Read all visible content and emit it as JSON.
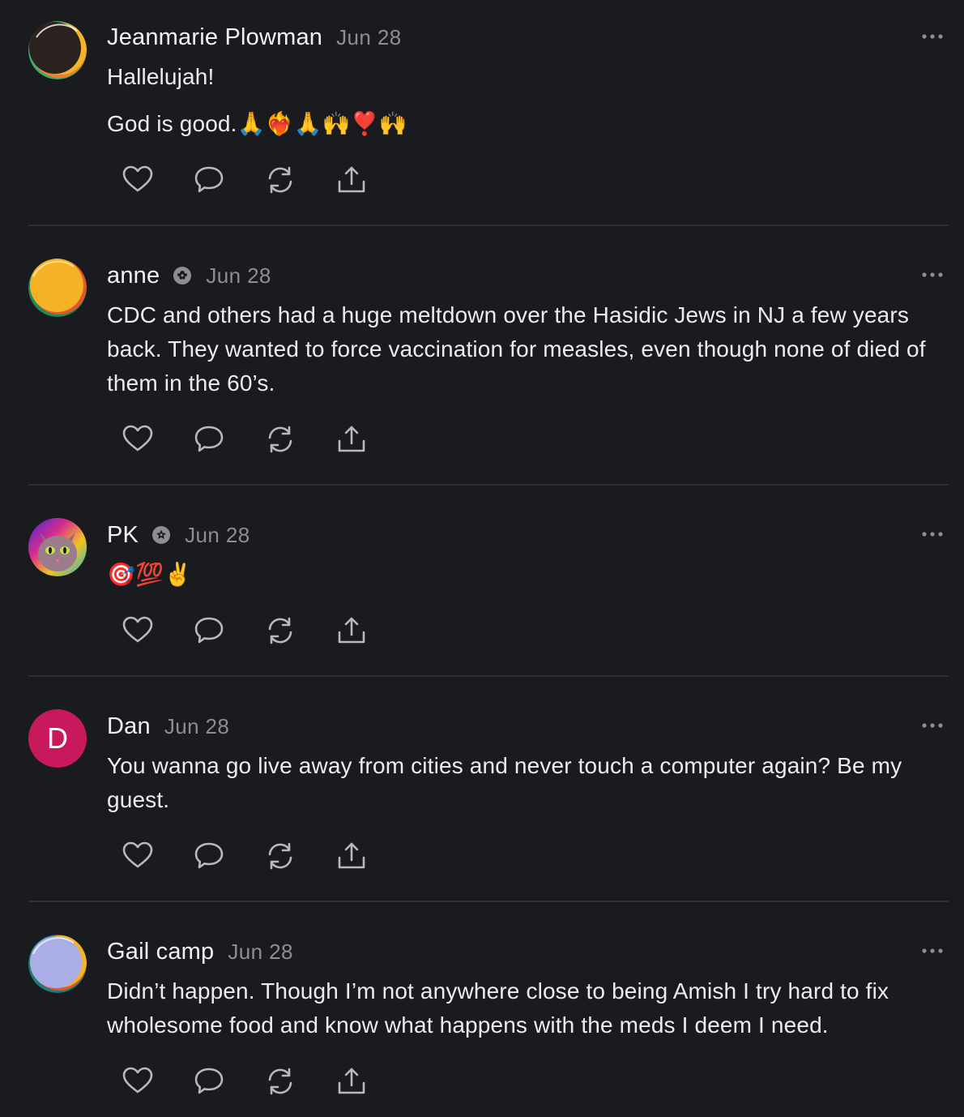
{
  "comments": [
    {
      "author": "Jeanmarie Plowman",
      "date": "Jun 28",
      "has_badge": false,
      "avatar_type": "abstract-dark",
      "paragraphs": [
        "Hallelujah!",
        "God is good.🙏❤️‍🔥🙏🙌❣️🙌"
      ]
    },
    {
      "author": "anne",
      "date": "Jun 28",
      "has_badge": true,
      "avatar_type": "abstract-yellow",
      "paragraphs": [
        "CDC and others had a huge meltdown over the Hasidic Jews in NJ a few years back. They wanted to force vaccination for measles, even though none of died of them in the 60’s."
      ]
    },
    {
      "author": "PK",
      "date": "Jun 28",
      "has_badge": true,
      "avatar_type": "cat-photo",
      "paragraphs": [
        "🎯💯✌️"
      ]
    },
    {
      "author": "Dan",
      "date": "Jun 28",
      "has_badge": false,
      "avatar_type": "letter",
      "avatar_letter": "D",
      "avatar_color": "#c8195c",
      "paragraphs": [
        "You wanna go live away from cities and never touch a computer again? Be my guest."
      ]
    },
    {
      "author": "Gail camp",
      "date": "Jun 28",
      "has_badge": false,
      "avatar_type": "abstract-lavender",
      "paragraphs": [
        "Didn’t happen. Though I’m not anywhere close to being Amish I try hard to fix wholesome food and know what happens with the meds I deem I need."
      ]
    }
  ],
  "actions": {
    "like_icon": "heart-icon",
    "reply_icon": "comment-bubble-icon",
    "restack_icon": "restack-icon",
    "share_icon": "share-icon",
    "more_icon": "more-options-icon"
  },
  "colors": {
    "background": "#1a1b1e",
    "text": "#ececef",
    "muted": "#8d8e93",
    "divider": "#2f3035",
    "dan_avatar": "#c8195c"
  }
}
